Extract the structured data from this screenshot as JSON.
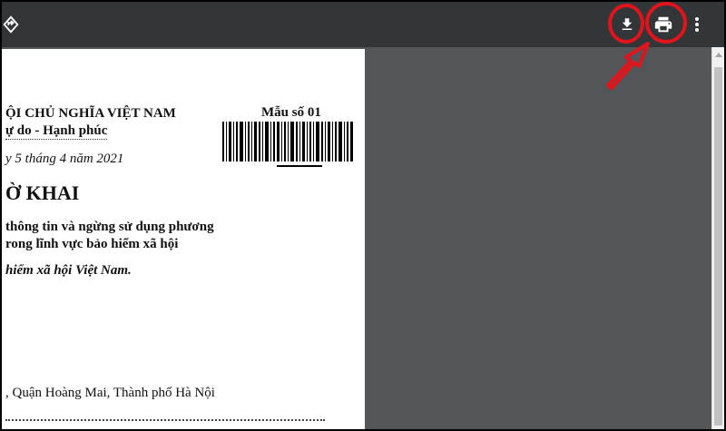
{
  "toolbar": {
    "rotate_icon": "rotate-icon",
    "download_icon": "download-icon",
    "print_icon": "print-icon",
    "more_icon": "more-vert-icon",
    "highlight_color": "#e0141b"
  },
  "document": {
    "line1": "ỘI CHỦ NGHĨA VIỆT NAM",
    "line2": "ự do - Hạnh phúc",
    "form_code": "Mẫu số 01",
    "date_line": "y 5 tháng 4 năm 2021",
    "title": "Ờ KHAI",
    "subtitle1": "thông tin và ngừng sử dụng phương",
    "subtitle2": "rong lĩnh vực bảo hiểm xã hội",
    "recipient": "hiểm xã hội Việt Nam.",
    "address": ", Quận Hoàng Mai, Thành phố Hà Nội"
  }
}
